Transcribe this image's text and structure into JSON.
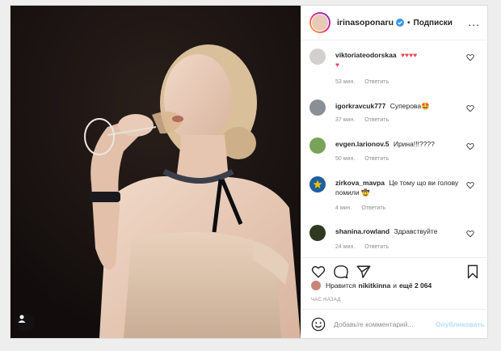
{
  "header": {
    "username": "irinasoponaru",
    "separator": "•",
    "follow_label": "Подписки",
    "more_label": "..."
  },
  "comments": [
    {
      "user": "viktoriateodorskaa",
      "text": "♥♥♥♥\n♥",
      "time": "53 мин.",
      "reply": "Ответить",
      "avatar_color": "#d3cfcf"
    },
    {
      "user": "igorkravcuk777",
      "text": "Суперова🤩",
      "time": "37 мин.",
      "reply": "Ответить",
      "avatar_color": "#8a8f96"
    },
    {
      "user": "evgen.larionov.5",
      "text": "Ирина!!!????",
      "time": "50 мин.",
      "reply": "Ответить",
      "avatar_color": "#7aa35a"
    },
    {
      "user": "zirkova_mavpa",
      "text": "Це тому що ви голову помили 🤠",
      "time": "4 мин.",
      "reply": "Ответить",
      "avatar_color": "#1d5fa0"
    },
    {
      "user": "shanina.rowland",
      "text": "Здравствуйте",
      "time": "24 мин.",
      "reply": "Ответить",
      "avatar_color": "#2e3a1f"
    }
  ],
  "likes": {
    "prefix": "Нравится",
    "user": "nikitkinna",
    "middle": "и",
    "count_text": "ещё 2 064"
  },
  "time_ago": "ЧАС НАЗАД",
  "add_comment": {
    "placeholder": "Добавьте комментарий...",
    "publish_label": "Опубликовать"
  },
  "colors": {
    "verified": "#3897f0",
    "heart_red": "#ed4956",
    "publish_disabled": "#b2dffc"
  }
}
